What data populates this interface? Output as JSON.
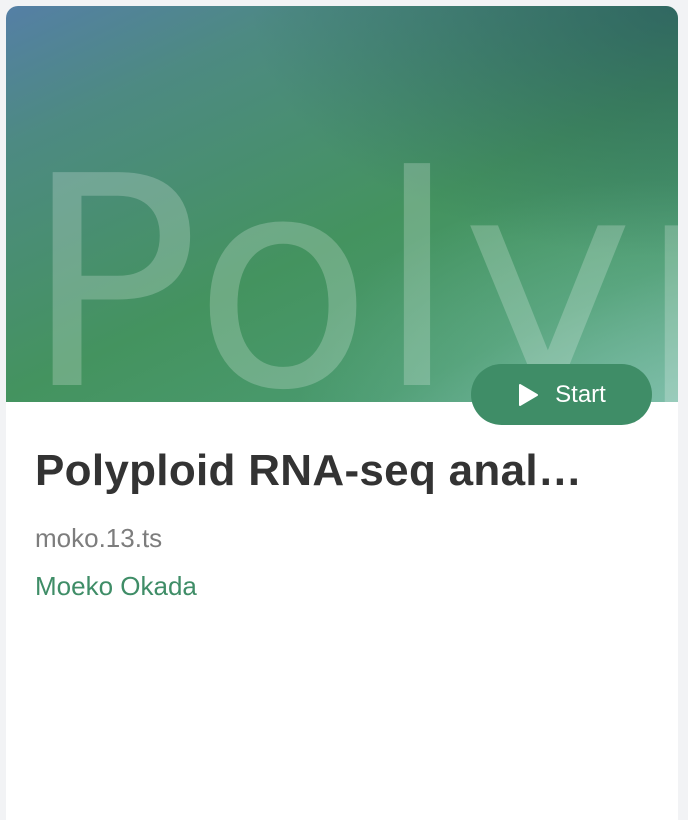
{
  "banner": {
    "word": "Polyp",
    "gradient_colors": [
      "#557fa6",
      "#44935f",
      "#69ad97"
    ]
  },
  "start_button": {
    "label": "Start",
    "icon": "play-icon",
    "color": "#3f8d67"
  },
  "card": {
    "title": "Polyploid RNA-seq anal…",
    "filename": "moko.13.ts",
    "author": "Moeko Okada",
    "author_color": "#3f8d67"
  }
}
